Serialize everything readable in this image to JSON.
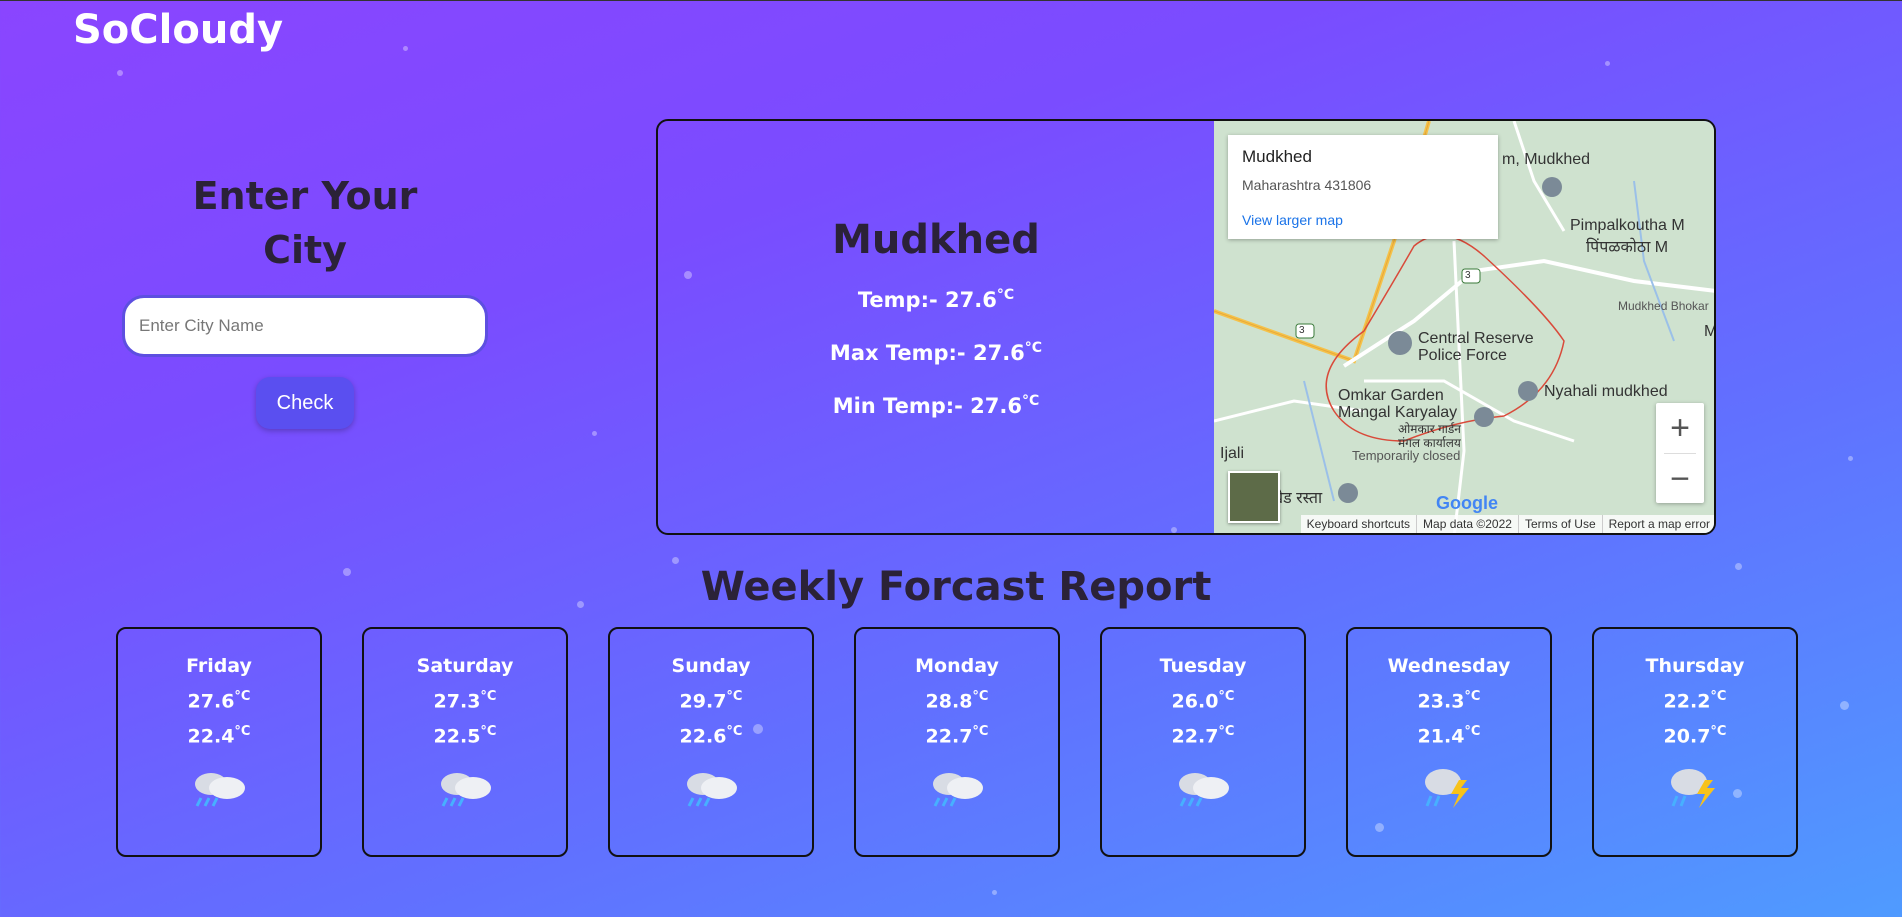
{
  "brand": "SoCloudy",
  "search": {
    "heading_line1": "Enter Your",
    "heading_line2": "City",
    "placeholder": "Enter City Name",
    "button": "Check"
  },
  "current": {
    "city": "Mudkhed",
    "temp_label": "Temp:- 27.6",
    "max_label": "Max Temp:- 27.6",
    "min_label": "Min Temp:- 27.6",
    "unit": "°C"
  },
  "map": {
    "place": "Mudkhed",
    "address": "Maharashtra 431806",
    "larger_link": "View larger map",
    "labels": {
      "top": "m, Mudkhed",
      "pimpal": "Pimpalkoutha M",
      "pimpal_mr": "पिंपळकोठा M",
      "bhokar": "Mudkhed Bhokar",
      "crpf1": "Central Reserve",
      "crpf2": "Police Force",
      "omkar1": "Omkar Garden",
      "omkar2": "Mangal Karyalay",
      "omkar_mr1": "ओमकार गार्डन",
      "omkar_mr2": "मंगल कार्यालय",
      "closed": "Temporarily closed",
      "nyahali": "Nyahali mudkhed",
      "ijali": "Ijali",
      "bottom": "खेड रस्ता",
      "road": "3",
      "edge": "M"
    },
    "zoom_in": "+",
    "zoom_out": "−",
    "google": "Google",
    "attribution": [
      "Keyboard shortcuts",
      "Map data ©2022",
      "Terms of Use",
      "Report a map error"
    ]
  },
  "weekly_title": "Weekly Forcast Report",
  "unit": "°C",
  "days": [
    {
      "day": "Friday",
      "max": "27.6",
      "min": "22.4",
      "icon": "rain-cloud-icon"
    },
    {
      "day": "Saturday",
      "max": "27.3",
      "min": "22.5",
      "icon": "rain-cloud-icon"
    },
    {
      "day": "Sunday",
      "max": "29.7",
      "min": "22.6",
      "icon": "rain-cloud-icon"
    },
    {
      "day": "Monday",
      "max": "28.8",
      "min": "22.7",
      "icon": "rain-cloud-icon"
    },
    {
      "day": "Tuesday",
      "max": "26.0",
      "min": "22.7",
      "icon": "rain-cloud-icon"
    },
    {
      "day": "Wednesday",
      "max": "23.3",
      "min": "21.4",
      "icon": "thunderstorm-icon"
    },
    {
      "day": "Thursday",
      "max": "22.2",
      "min": "20.7",
      "icon": "thunderstorm-icon"
    }
  ]
}
